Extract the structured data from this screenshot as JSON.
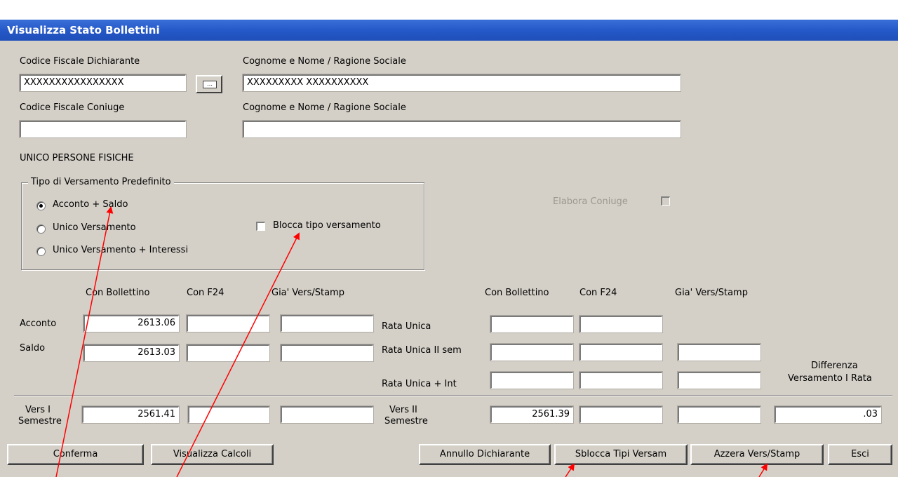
{
  "window": {
    "title": "Visualizza Stato Bollettini"
  },
  "dichiarante": {
    "cf_label": "Codice Fiscale Dichiarante",
    "cf_value": "XXXXXXXXXXXXXXXX",
    "nome_label": "Cognome e Nome / Ragione Sociale",
    "nome_value": "XXXXXXXXX   XXXXXXXXXX"
  },
  "coniuge": {
    "cf_label": "Codice Fiscale Coniuge",
    "cf_value": "",
    "nome_label": "Cognome e Nome / Ragione Sociale",
    "nome_value": ""
  },
  "section_title": "UNICO PERSONE FISICHE",
  "tipo_versamento": {
    "group_label": "Tipo di Versamento Predefinito",
    "options": [
      {
        "label": "Acconto + Saldo",
        "selected": true
      },
      {
        "label": "Unico Versamento",
        "selected": false
      },
      {
        "label": "Unico Versamento + Interessi",
        "selected": false
      }
    ],
    "blocca_label": "Blocca tipo versamento",
    "blocca_checked": false
  },
  "elabora_coniuge": {
    "label": "Elabora Coniuge",
    "checked": false,
    "disabled": true
  },
  "left_table": {
    "headers": [
      "Con Bollettino",
      "Con F24",
      "Gia' Vers/Stamp"
    ],
    "rows": [
      {
        "label": "Acconto",
        "values": [
          "2613.06",
          "",
          ""
        ]
      },
      {
        "label": "Saldo",
        "values": [
          "2613.03",
          "",
          ""
        ]
      }
    ]
  },
  "right_table": {
    "headers": [
      "Con Bollettino",
      "Con F24",
      "Gia' Vers/Stamp"
    ],
    "rows": [
      {
        "label": "Rata Unica",
        "values": [
          "",
          ""
        ]
      },
      {
        "label": "Rata Unica II sem",
        "values": [
          "",
          "",
          ""
        ]
      },
      {
        "label": "Rata Unica + Int",
        "values": [
          "",
          "",
          ""
        ]
      }
    ],
    "diff_label_1": "Differenza",
    "diff_label_2": "Versamento I Rata"
  },
  "semestri": {
    "vers1_label_1": "Vers I",
    "vers1_label_2": "Semestre",
    "vers1_values": [
      "2561.41",
      "",
      ""
    ],
    "vers2_label_1": "Vers II",
    "vers2_label_2": "Semestre",
    "vers2_values": [
      "2561.39",
      "",
      ""
    ],
    "differenza_value": ".03"
  },
  "buttons": {
    "conferma": "Conferma",
    "visualizza_calcoli": "Visualizza Calcoli",
    "annullo_dichiarante": "Annullo Dichiarante",
    "sblocca_tipi": "Sblocca Tipi Versam",
    "azzera": "Azzera Vers/Stamp",
    "esci": "Esci"
  },
  "colors": {
    "titlebar": "#2457c7",
    "face": "#d4d0c8",
    "annotation_arrow": "#ff0000"
  }
}
